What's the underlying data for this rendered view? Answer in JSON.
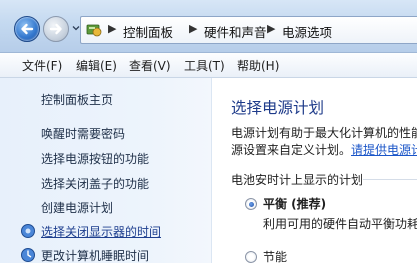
{
  "address_bar": {
    "breadcrumbs": [
      "控制面板",
      "硬件和声音",
      "电源选项"
    ],
    "icon": "control-panel-icon"
  },
  "menu": {
    "items": [
      "文件(F)",
      "编辑(E)",
      "查看(V)",
      "工具(T)",
      "帮助(H)"
    ]
  },
  "sidebar": {
    "home": "控制面板主页",
    "tasks": [
      "唤醒时需要密码",
      "选择电源按钮的功能",
      "选择关闭盖子的功能",
      "创建电源计划",
      "选择关闭显示器的时间",
      "更改计算机睡眠时间"
    ],
    "highlighted_index": 4
  },
  "main": {
    "title": "选择电源计划",
    "description_line1": "电源计划有助于最大化计算机的性能",
    "description_line2_prefix": "源设置来自定义计划。",
    "description_link": "请提供电源计",
    "section_title": "电池安时计上显示的计划",
    "plans": [
      {
        "name": "平衡 (推荐)",
        "selected": true,
        "description": "利用可用的硬件自动平衡功耗与"
      },
      {
        "name": "节能",
        "selected": false
      }
    ]
  }
}
